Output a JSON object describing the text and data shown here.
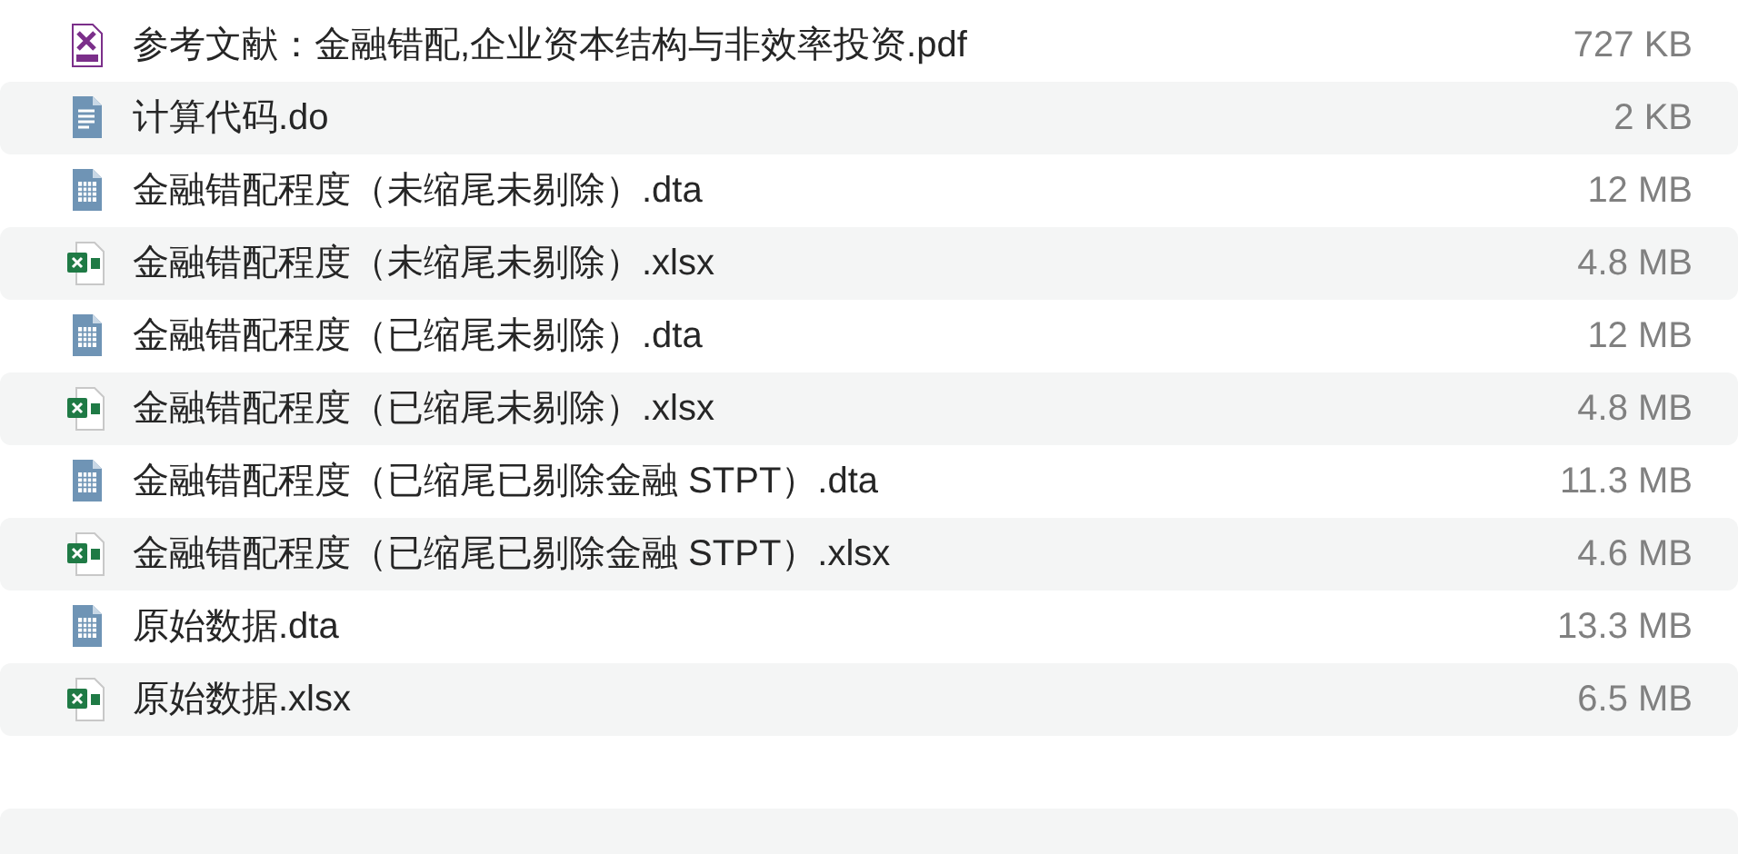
{
  "files": [
    {
      "kind": "pdf",
      "name": "参考文献：金融错配,企业资本结构与非效率投资.pdf",
      "size": "727 KB"
    },
    {
      "kind": "text",
      "name": "计算代码.do",
      "size": "2 KB"
    },
    {
      "kind": "table",
      "name": "金融错配程度（未缩尾未剔除）.dta",
      "size": "12 MB"
    },
    {
      "kind": "excel",
      "name": "金融错配程度（未缩尾未剔除）.xlsx",
      "size": "4.8 MB"
    },
    {
      "kind": "table",
      "name": "金融错配程度（已缩尾未剔除）.dta",
      "size": "12 MB"
    },
    {
      "kind": "excel",
      "name": "金融错配程度（已缩尾未剔除）.xlsx",
      "size": "4.8 MB"
    },
    {
      "kind": "table",
      "name": "金融错配程度（已缩尾已剔除金融 STPT）.dta",
      "size": "11.3 MB"
    },
    {
      "kind": "excel",
      "name": "金融错配程度（已缩尾已剔除金融 STPT）.xlsx",
      "size": "4.6 MB"
    },
    {
      "kind": "table",
      "name": "原始数据.dta",
      "size": "13.3 MB"
    },
    {
      "kind": "excel",
      "name": "原始数据.xlsx",
      "size": "6.5 MB"
    }
  ]
}
